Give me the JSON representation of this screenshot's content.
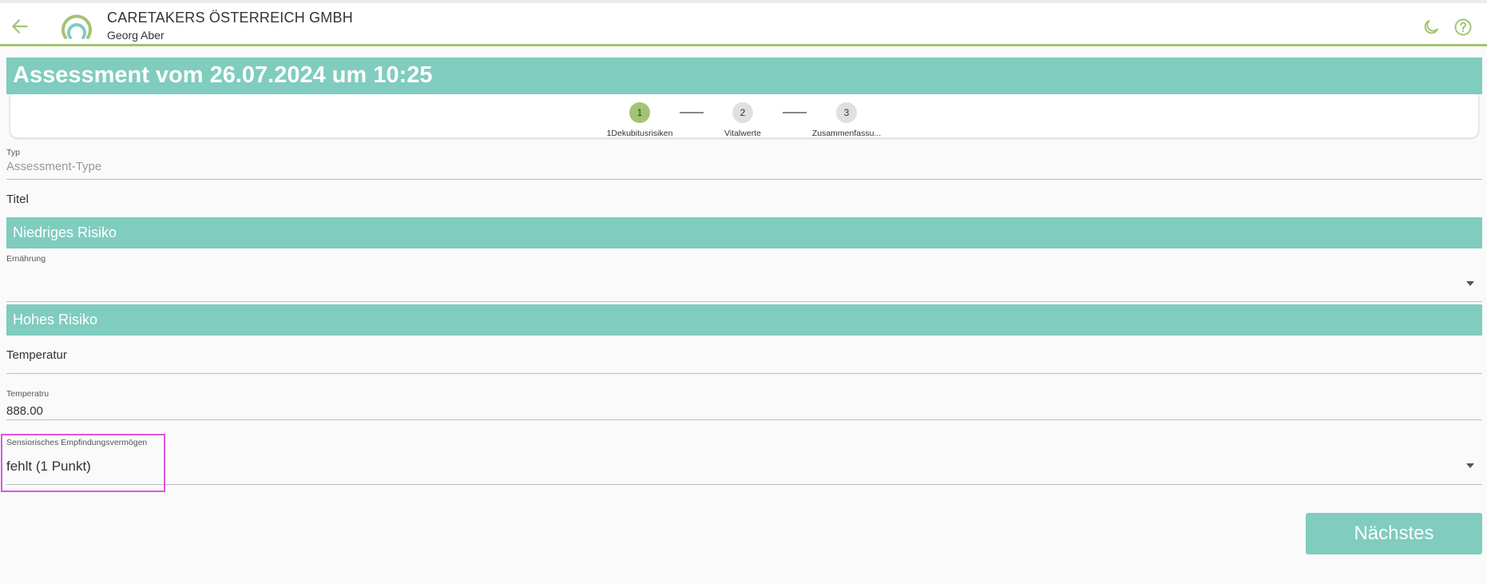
{
  "header": {
    "company": "CARETAKERS ÖSTERREICH GMBH",
    "person": "Georg Aber",
    "icons": {
      "back": "arrow-left-icon",
      "theme": "moon-icon",
      "help": "help-circle-icon",
      "logo": "caretakers-logo"
    }
  },
  "page": {
    "title": "Assessment vom 26.07.2024 um 10:25"
  },
  "stepper": {
    "steps": [
      {
        "number": "1",
        "label": "1Dekubitusrisiken",
        "active": true
      },
      {
        "number": "2",
        "label": "Vitalwerte",
        "active": false
      },
      {
        "number": "3",
        "label": "Zusammenfassu...",
        "active": false
      }
    ]
  },
  "form": {
    "typ_label": "Typ",
    "typ_placeholder": "Assessment-Type",
    "titel_label": "Titel",
    "section_low": "Niedriges Risiko",
    "ernaehrung_label": "Ernährung",
    "ernaehrung_value": "",
    "section_high": "Hohes Risiko",
    "temperatur_label": "Temperatur",
    "temperatru_label": "Temperatru",
    "temperatru_value": "888.00",
    "sensorik_label": "Sensiorisches Empfindungsvermögen",
    "sensorik_value": "fehlt (1 Punkt)"
  },
  "actions": {
    "next_label": "Nächstes"
  },
  "colors": {
    "accent": "#80ccbe",
    "green": "#a2c472",
    "highlight": "#e055e0"
  }
}
